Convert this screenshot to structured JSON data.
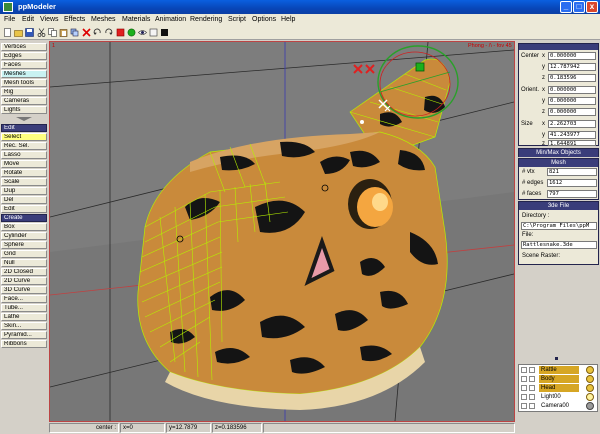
{
  "app": {
    "title": "ppModeler"
  },
  "window_controls": {
    "minimize": "_",
    "maximize": "□",
    "close": "x"
  },
  "menu": [
    "File",
    "Edit",
    "Views",
    "Effects",
    "Meshes",
    "Materials",
    "Animation",
    "Rendering",
    "Script",
    "Options",
    "Help"
  ],
  "viewport": {
    "mode_label": "Phong - /\\ - fov 45"
  },
  "left_panel": {
    "categories": [
      "Vertices",
      "Edges",
      "Faces",
      "Meshes",
      "Mesh tools",
      "Rig",
      "Cameras",
      "Lights"
    ],
    "active_category": "Meshes",
    "edit_header": "Edit",
    "edit_tools": [
      "Select",
      "Rec. Sel.",
      "Lasso",
      "Move",
      "Rotate",
      "Scale",
      "Dup",
      "Del",
      "Edit"
    ],
    "create_header": "Create",
    "create_tools": [
      "Box",
      "Cylinder",
      "Sphere",
      "Grid",
      "Null",
      "2D Closed",
      "2D Curve",
      "3D Curve",
      "Face...",
      "Tube...",
      "Lathe",
      "Skin...",
      "Pyramid...",
      "Ribbons"
    ]
  },
  "right_panel": {
    "transform": {
      "center_label": "Center",
      "center": {
        "x": "0.000000",
        "y": "12.787942",
        "z": "0.183596"
      },
      "orient_label": "Orient.",
      "orient": {
        "x": "0.000000",
        "y": "0.000000",
        "z": "0.000000"
      },
      "size_label": "Size",
      "size": {
        "x": "2.262703",
        "y": "41.243977",
        "z": "1.644891"
      }
    },
    "minmax_label": "Min/Max Objects",
    "mesh": {
      "header": "Mesh",
      "vtx_label": "# vtx",
      "vtx": "821",
      "edges_label": "# edges",
      "edges": "1612",
      "faces_label": "# faces",
      "faces": "797"
    },
    "file": {
      "header": "3de File",
      "directory_label": "Directory :",
      "directory": "C:\\Program Files\\ppM",
      "file_label": "File:",
      "file": "Rattlesnake.3de",
      "scene_raster_label": "Scene Raster:"
    },
    "objects": [
      {
        "name": "Rattle",
        "selected": true,
        "light": true
      },
      {
        "name": "Body",
        "selected": true,
        "light": true
      },
      {
        "name": "Head",
        "selected": true,
        "light": true
      },
      {
        "name": "Light00",
        "selected": false,
        "light": true
      },
      {
        "name": "Camera00",
        "selected": false,
        "light": false
      }
    ]
  },
  "status": {
    "mode": "center :",
    "x": "x=0",
    "y": "y=12.7879",
    "z": "z=0.183596"
  },
  "colors": {
    "title_bar": "#0846b8",
    "panel_header": "#3a3d7a",
    "snake_body": "#c98a3b",
    "snake_spots": "#141414",
    "viewport_bg": "#7b7b7b",
    "selected_wire": "#b6f000"
  }
}
